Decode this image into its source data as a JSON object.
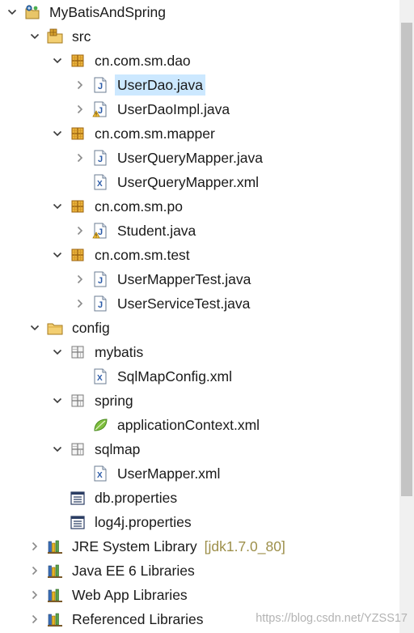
{
  "rows": [
    {
      "name": "tree-item-mybatisandspring",
      "depth": 0,
      "twisty": "expanded",
      "icon": "project-icon",
      "label": "MyBatisAndSpring"
    },
    {
      "name": "tree-item-src",
      "depth": 1,
      "twisty": "expanded",
      "icon": "source-folder-icon",
      "label": "src"
    },
    {
      "name": "tree-item-cn-com-sm-dao",
      "depth": 2,
      "twisty": "expanded",
      "icon": "package-icon",
      "label": "cn.com.sm.dao"
    },
    {
      "name": "tree-item-userdao-java",
      "depth": 3,
      "twisty": "collapsed",
      "icon": "java-file-icon",
      "label": "UserDao.java",
      "selected": true
    },
    {
      "name": "tree-item-userdaoimpl-java",
      "depth": 3,
      "twisty": "collapsed",
      "icon": "java-file-warning-icon",
      "label": "UserDaoImpl.java"
    },
    {
      "name": "tree-item-cn-com-sm-mapper",
      "depth": 2,
      "twisty": "expanded",
      "icon": "package-icon",
      "label": "cn.com.sm.mapper"
    },
    {
      "name": "tree-item-userquerymapper-java",
      "depth": 3,
      "twisty": "collapsed",
      "icon": "java-file-icon",
      "label": "UserQueryMapper.java"
    },
    {
      "name": "tree-item-userquerymapper-xml",
      "depth": 3,
      "twisty": "none",
      "icon": "xml-file-icon",
      "label": "UserQueryMapper.xml"
    },
    {
      "name": "tree-item-cn-com-sm-po",
      "depth": 2,
      "twisty": "expanded",
      "icon": "package-icon",
      "label": "cn.com.sm.po"
    },
    {
      "name": "tree-item-student-java",
      "depth": 3,
      "twisty": "collapsed",
      "icon": "java-file-warning-icon",
      "label": "Student.java"
    },
    {
      "name": "tree-item-cn-com-sm-test",
      "depth": 2,
      "twisty": "expanded",
      "icon": "package-icon",
      "label": "cn.com.sm.test"
    },
    {
      "name": "tree-item-usermappertest-java",
      "depth": 3,
      "twisty": "collapsed",
      "icon": "java-file-icon",
      "label": "UserMapperTest.java"
    },
    {
      "name": "tree-item-userservicetest-java",
      "depth": 3,
      "twisty": "collapsed",
      "icon": "java-file-icon",
      "label": "UserServiceTest.java"
    },
    {
      "name": "tree-item-config",
      "depth": 1,
      "twisty": "expanded",
      "icon": "folder-icon",
      "label": "config"
    },
    {
      "name": "tree-item-mybatis",
      "depth": 2,
      "twisty": "expanded",
      "icon": "empty-package-icon",
      "label": "mybatis"
    },
    {
      "name": "tree-item-sqlmapconfig-xml",
      "depth": 3,
      "twisty": "none",
      "icon": "xml-file-icon",
      "label": "SqlMapConfig.xml"
    },
    {
      "name": "tree-item-spring",
      "depth": 2,
      "twisty": "expanded",
      "icon": "empty-package-icon",
      "label": "spring"
    },
    {
      "name": "tree-item-applicationcontext-xml",
      "depth": 3,
      "twisty": "none",
      "icon": "spring-leaf-icon",
      "label": "applicationContext.xml"
    },
    {
      "name": "tree-item-sqlmap",
      "depth": 2,
      "twisty": "expanded",
      "icon": "empty-package-icon",
      "label": "sqlmap"
    },
    {
      "name": "tree-item-usermapper-xml",
      "depth": 3,
      "twisty": "none",
      "icon": "xml-file-icon",
      "label": "UserMapper.xml"
    },
    {
      "name": "tree-item-db-properties",
      "depth": 2,
      "twisty": "none",
      "icon": "properties-file-icon",
      "label": "db.properties"
    },
    {
      "name": "tree-item-log4j-properties",
      "depth": 2,
      "twisty": "none",
      "icon": "properties-file-icon",
      "label": "log4j.properties"
    },
    {
      "name": "tree-item-jre-system-library",
      "depth": 1,
      "twisty": "collapsed",
      "icon": "library-icon",
      "label": "JRE System Library",
      "decoration": "[jdk1.7.0_80]"
    },
    {
      "name": "tree-item-java-ee-6-libraries",
      "depth": 1,
      "twisty": "collapsed",
      "icon": "library-icon",
      "label": "Java EE 6 Libraries"
    },
    {
      "name": "tree-item-web-app-libraries",
      "depth": 1,
      "twisty": "collapsed",
      "icon": "library-icon",
      "label": "Web App Libraries"
    },
    {
      "name": "tree-item-referenced-libraries",
      "depth": 1,
      "twisty": "collapsed",
      "icon": "library-icon",
      "label": "Referenced Libraries"
    }
  ],
  "watermark": "https://blog.csdn.net/YZSS17",
  "colors": {
    "selection": "#cce8ff",
    "text": "#1a1a1a",
    "decoration": "#9d8f4a",
    "scrollbar_track": "#f0f0f0",
    "scrollbar_thumb": "#c4c4c4"
  }
}
